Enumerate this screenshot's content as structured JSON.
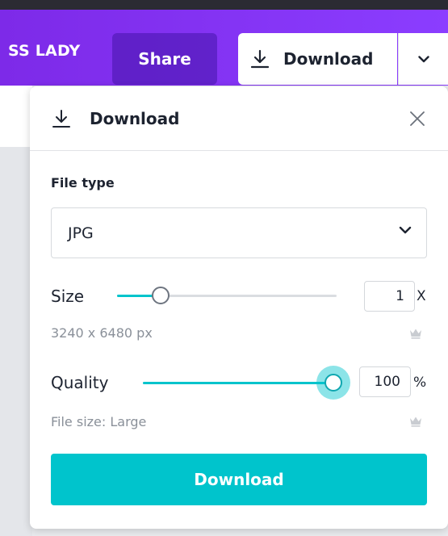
{
  "topbar": {
    "doc_title": "SS LADY",
    "share_label": "Share",
    "download_label": "Download"
  },
  "panel": {
    "title": "Download",
    "file_type_label": "File type",
    "file_type_value": "JPG",
    "size": {
      "label": "Size",
      "value": "1",
      "unit": "X",
      "dimensions": "3240 x 6480 px",
      "slider_fraction": 0.2
    },
    "quality": {
      "label": "Quality",
      "value": "100",
      "unit": "%",
      "file_size": "File size: Large",
      "slider_fraction": 1.0
    },
    "download_button": "Download"
  },
  "colors": {
    "brand_purple": "#8b3dff",
    "accent_teal": "#00c4cc"
  },
  "icons": [
    "download-icon",
    "chevron-down-icon",
    "close-icon",
    "crown-icon"
  ]
}
